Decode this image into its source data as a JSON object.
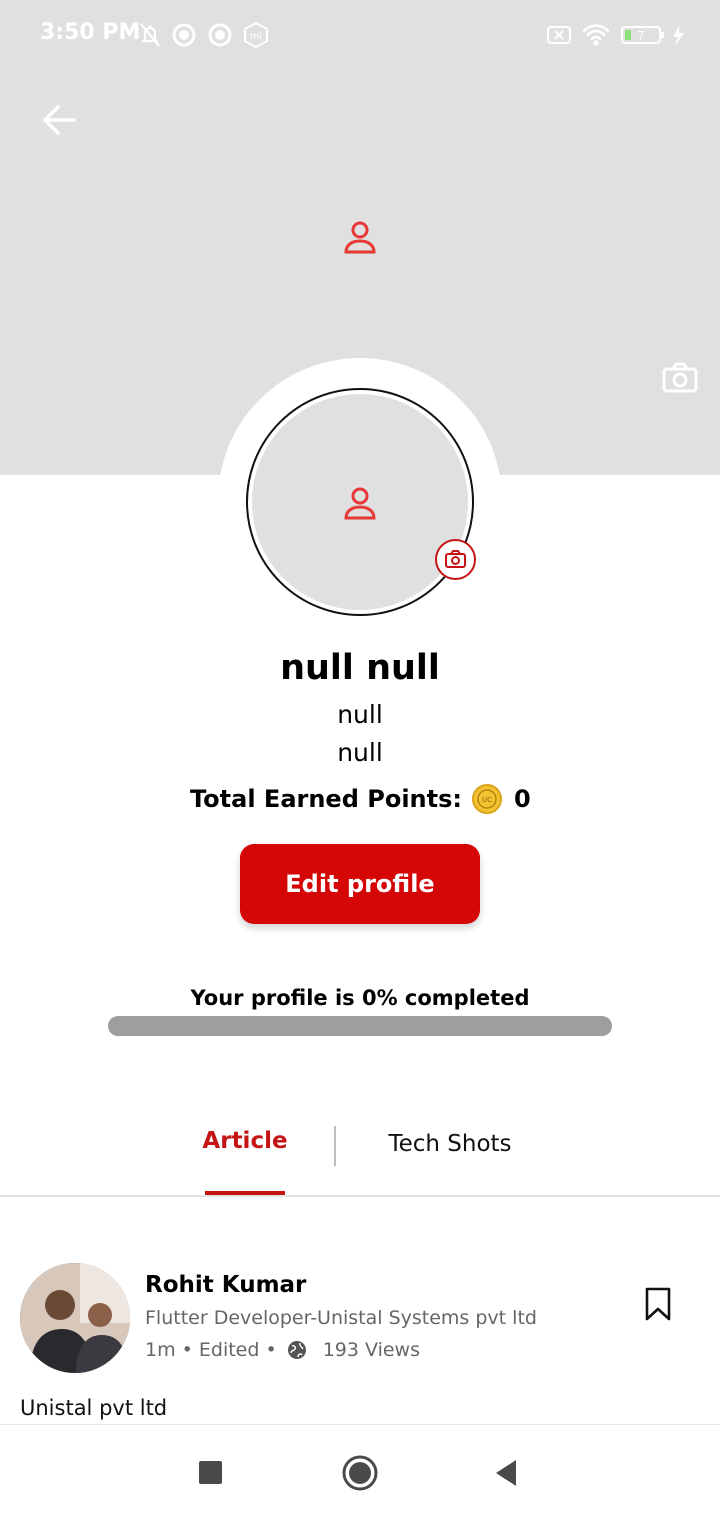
{
  "status_bar": {
    "time": "3:50 PM",
    "battery_level": "7",
    "icons_left": [
      "muted-bell-icon",
      "app-notification-icon",
      "app-notification-icon",
      "mi-icon"
    ],
    "icons_right": [
      "no-sim-icon",
      "wifi-icon",
      "battery-icon",
      "charging-icon"
    ]
  },
  "header": {
    "back_icon": "arrow-left-icon",
    "cover_placeholder_icon": "user-icon",
    "cover_camera_icon": "camera-icon"
  },
  "profile": {
    "name": "null null",
    "line1": "null",
    "line2": "null",
    "points_label": "Total Earned Points:",
    "points_value": "0",
    "edit_button_label": "Edit profile",
    "completion_text": "Your profile is 0% completed",
    "completion_fraction": 0
  },
  "tabs": [
    {
      "label": "Article",
      "active": true
    },
    {
      "label": "Tech Shots",
      "active": false
    }
  ],
  "post": {
    "author": "Rohit Kumar",
    "subtitle": "Flutter Developer-Unistal Systems pvt ltd",
    "meta_time": "1m • Edited •",
    "views": "193 Views",
    "text": "Unistal pvt ltd"
  },
  "colors": {
    "accent": "#d40606",
    "tab_active": "#c41414",
    "cover_bg": "#e0e0e0",
    "progress_track": "#9e9e9e"
  }
}
